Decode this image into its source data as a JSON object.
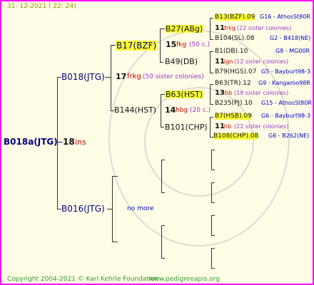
{
  "header": {
    "date": "31- 12-2021 ( 22: 24)"
  },
  "footer": {
    "copyright": "Copyright 2004-2021 © Karl Kehrle Foundation",
    "url": "www.pedigreeapis.org"
  },
  "root": {
    "code": "B018a(JTG)",
    "number": "18",
    "tag": "ins"
  },
  "gen1": {
    "father": {
      "code": "B018(JTG)",
      "number": "17",
      "tag": "frkg",
      "note": "(50 sister colonies)"
    },
    "mother": {
      "code": "B016(JTG)",
      "note": "no more"
    }
  },
  "gen2": {
    "ff": {
      "code": "B17(BZF)",
      "number": "15",
      "tag": "fkg",
      "note": "(50 c.)"
    },
    "fm": {
      "code": "B144(HST)",
      "number": "14",
      "tag": "hbg",
      "note": "(20 c.)"
    }
  },
  "gen3": [
    {
      "code": "B27(ABg)"
    },
    {
      "code": "B49(DB)"
    },
    {
      "code": "B63(HST)"
    },
    {
      "code": "B101(CHP)"
    }
  ],
  "gen4": [
    {
      "code": "B13(BZF).09",
      "line": "G16 - AthosSt80R"
    },
    {
      "number": "11",
      "tag": "frkg",
      "note": "(22 sister colonies)"
    },
    {
      "code": "B104(SL).08",
      "line": "G2 - B418(NE)"
    },
    {
      "code": "B1(DB).10",
      "line": "G8 - MG00R"
    },
    {
      "number": "11",
      "tag": "lgn",
      "note": "(12 sister colonies)"
    },
    {
      "code": "B79(HGS).07",
      "line": "G5 - Bayburt98-3"
    },
    {
      "code": "B63(TR).12",
      "line": "G9 - Kangaroo98R"
    },
    {
      "number": "13",
      "tag": "hb",
      "note": "(18 sister colonies)"
    },
    {
      "code": "B235(PJ).10",
      "line": "G15 - AthosSt80R"
    },
    {
      "code": "B7(HSB).09",
      "line": "G6 - Bayburt98-3"
    },
    {
      "number": "11",
      "tag": "hb",
      "note": "(22 sister colonies)"
    },
    {
      "code": "B108(CHP).08",
      "line": "G6 - B262(NE)"
    }
  ]
}
